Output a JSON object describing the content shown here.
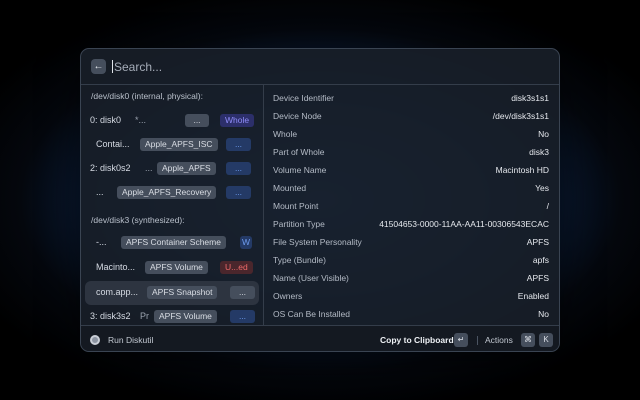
{
  "search": {
    "placeholder": "Search..."
  },
  "icons": {
    "back": "arrow-left-icon",
    "extension": "disk-icon"
  },
  "colors": {
    "accent": "#6e9cf0",
    "purple": "#8f8cf8",
    "red": "#f06a6a"
  },
  "list": {
    "sections": [
      {
        "title": "/dev/disk0 (internal, physical):"
      },
      {
        "title": "/dev/disk3 (synthesized):"
      }
    ],
    "rows": [
      {
        "title": "0: disk0",
        "subtitle": "*...",
        "tags": [
          "...",
          "Whole"
        ]
      },
      {
        "title": "Contai...",
        "subtitle": "",
        "tags": [
          "Apple_APFS_ISC",
          "..."
        ]
      },
      {
        "title": "2: disk0s2",
        "subtitle": "...",
        "tags": [
          "Apple_APFS",
          "..."
        ]
      },
      {
        "title": "...",
        "subtitle": "",
        "tags": [
          "Apple_APFS_Recovery",
          "..."
        ]
      },
      {
        "title": "-...",
        "subtitle": "",
        "tags": [
          "APFS Container Scheme",
          "W"
        ]
      },
      {
        "title": "Macinto...",
        "subtitle": "",
        "tags": [
          "APFS Volume",
          "U...ed"
        ]
      },
      {
        "title": "com.app...",
        "subtitle": "",
        "tags": [
          "APFS Snapshot",
          "..."
        ]
      },
      {
        "title": "3: disk3s2",
        "subtitle": "Pr",
        "tags": [
          "APFS Volume",
          "..."
        ]
      }
    ]
  },
  "detail": {
    "rows": [
      {
        "key": "Device Identifier",
        "value": "disk3s1s1"
      },
      {
        "key": "Device Node",
        "value": "/dev/disk3s1s1"
      },
      {
        "key": "Whole",
        "value": "No"
      },
      {
        "key": "Part of Whole",
        "value": "disk3"
      },
      {
        "key": "Volume Name",
        "value": "Macintosh HD"
      },
      {
        "key": "Mounted",
        "value": "Yes"
      },
      {
        "key": "Mount Point",
        "value": "/"
      },
      {
        "key": "Partition Type",
        "value": "41504653-0000-11AA-AA11-00306543ECAC"
      },
      {
        "key": "File System Personality",
        "value": "APFS"
      },
      {
        "key": "Type (Bundle)",
        "value": "apfs"
      },
      {
        "key": "Name (User Visible)",
        "value": "APFS"
      },
      {
        "key": "Owners",
        "value": "Enabled"
      },
      {
        "key": "OS Can Be Installed",
        "value": "No"
      }
    ]
  },
  "footer": {
    "title": "Run Diskutil",
    "primary_action": "Copy to Clipboard",
    "primary_shortcut": "↵",
    "actions_label": "Actions",
    "actions_shortcut_mod": "⌘",
    "actions_shortcut_key": "K"
  }
}
